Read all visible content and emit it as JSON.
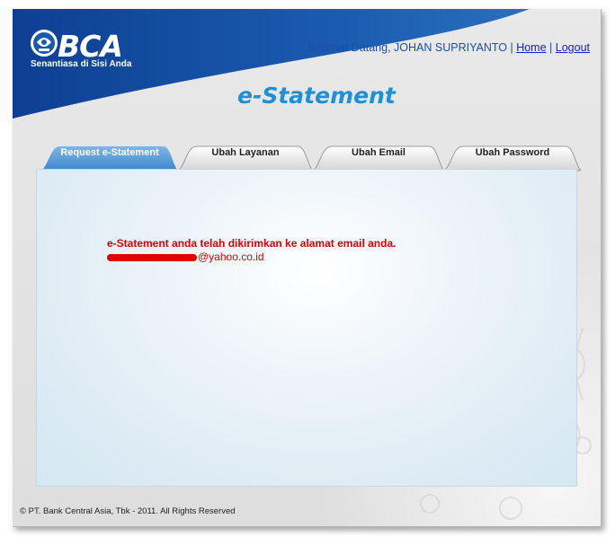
{
  "brand": {
    "name": "BCA",
    "tagline": "Senantiasa di Sisi Anda"
  },
  "header": {
    "welcome": "Selamat Datang, JOHAN SUPRIYANTO",
    "separator": "|",
    "home_link": "Home",
    "logout_link": "Logout"
  },
  "page": {
    "title": "e-Statement"
  },
  "tabs": [
    {
      "label": "Request e-Statement",
      "active": true
    },
    {
      "label": "Ubah Layanan",
      "active": false
    },
    {
      "label": "Ubah Email",
      "active": false
    },
    {
      "label": "Ubah Password",
      "active": false
    }
  ],
  "content": {
    "message": "e-Statement anda telah dikirimkan ke alamat email anda.",
    "email_domain": "@yahoo.co.id"
  },
  "footer": {
    "copyright": "© PT. Bank Central Asia, Tbk - 2011. All Rights Reserved"
  },
  "colors": {
    "brand_blue": "#1a5aae",
    "title_blue": "#1f8fd6",
    "message_red": "#e00000"
  }
}
